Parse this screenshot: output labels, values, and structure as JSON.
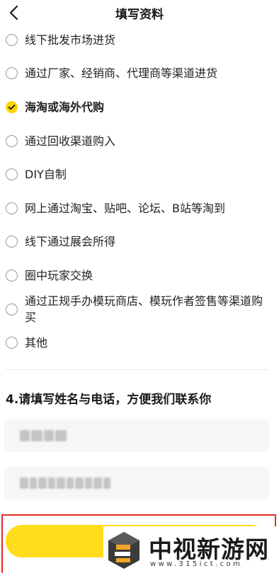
{
  "header": {
    "title": "填写资料"
  },
  "options": [
    {
      "label": "线下批发市场进货",
      "checked": false
    },
    {
      "label": "通过厂家、经销商、代理商等渠道进货",
      "checked": false
    },
    {
      "label": "海淘或海外代购",
      "checked": true
    },
    {
      "label": "通过回收渠道购入",
      "checked": false
    },
    {
      "label": "DIY自制",
      "checked": false
    },
    {
      "label": "网上通过淘宝、贴吧、论坛、B站等淘到",
      "checked": false
    },
    {
      "label": "线下通过展会所得",
      "checked": false
    },
    {
      "label": "圈中玩家交换",
      "checked": false
    },
    {
      "label": "通过正规手办模玩商店、模玩作者签售等渠道购买",
      "checked": false
    },
    {
      "label": "其他",
      "checked": false
    }
  ],
  "question4": {
    "title": "4.请填写姓名与电话，方便我们联系你"
  },
  "watermark": {
    "name": "中视新游网",
    "url": "www.315ict.com"
  },
  "colors": {
    "accent": "#ffd500",
    "button": "#ffdd1a",
    "highlight": "#e32b25"
  }
}
